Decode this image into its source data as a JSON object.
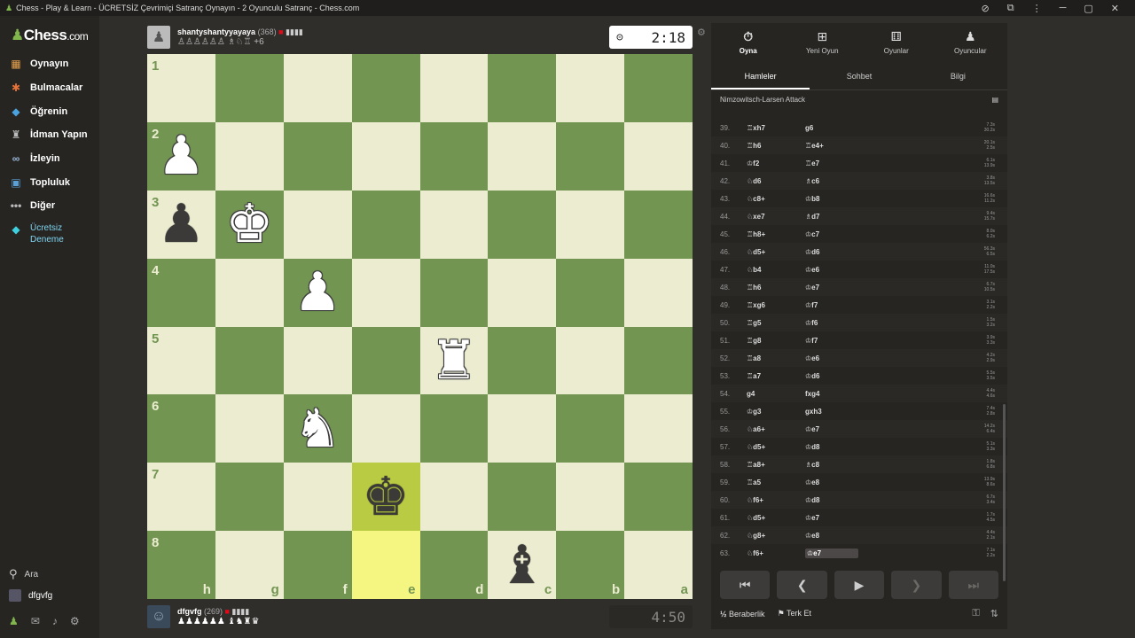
{
  "window": {
    "title": "Chess - Play & Learn - ÜCRETSİZ Çevrimiçi Satranç Oynayın - 2 Oyunculu Satranç - Chess.com"
  },
  "sidebar": {
    "logo_main": "Chess",
    "logo_dot": ".com",
    "items": [
      {
        "label": "Oynayın",
        "icon": "play-board-icon"
      },
      {
        "label": "Bulmacalar",
        "icon": "puzzle-icon"
      },
      {
        "label": "Öğrenin",
        "icon": "graduation-cap-icon"
      },
      {
        "label": "İdman Yapın",
        "icon": "train-icon"
      },
      {
        "label": "İzleyin",
        "icon": "binoculars-icon"
      },
      {
        "label": "Topluluk",
        "icon": "community-icon"
      },
      {
        "label": "Diğer",
        "icon": "more-dots-icon"
      },
      {
        "label": "Ücretsiz Deneme",
        "icon": "diamond-icon"
      }
    ],
    "search_label": "Ara",
    "username": "dfgvfg"
  },
  "top_player": {
    "name": "shantyshantyyayaya",
    "rating": "(368)",
    "captured": "♙♙♙♙♙♙ ♗♘♖ +6",
    "clock": "2:18"
  },
  "bottom_player": {
    "name": "dfgvfg",
    "rating": "(269)",
    "captured": "♟♟♟♟♟♟ ♝♞♜♛",
    "clock": "4:50"
  },
  "board": {
    "ranks": [
      "1",
      "2",
      "3",
      "4",
      "5",
      "6",
      "7",
      "8"
    ],
    "files": [
      "h",
      "g",
      "f",
      "e",
      "d",
      "c",
      "b",
      "a"
    ],
    "pieces": [
      {
        "sq": "h2",
        "glyph": "♟",
        "color": "w"
      },
      {
        "sq": "h3",
        "glyph": "♟",
        "color": "b"
      },
      {
        "sq": "g3",
        "glyph": "♚",
        "color": "w"
      },
      {
        "sq": "f4",
        "glyph": "♟",
        "color": "w"
      },
      {
        "sq": "d5",
        "glyph": "♜",
        "color": "w"
      },
      {
        "sq": "f6",
        "glyph": "♞",
        "color": "w"
      },
      {
        "sq": "e7",
        "glyph": "♚",
        "color": "b"
      },
      {
        "sq": "c8",
        "glyph": "♝",
        "color": "b"
      }
    ],
    "highlights": [
      "e7",
      "e8"
    ]
  },
  "panel": {
    "tabs": [
      {
        "label": "Oyna",
        "icon": "stopwatch-icon"
      },
      {
        "label": "Yeni Oyun",
        "icon": "plus-icon"
      },
      {
        "label": "Oyunlar",
        "icon": "dice-icon"
      },
      {
        "label": "Oyuncular",
        "icon": "players-icon"
      }
    ],
    "subtabs": [
      "Hamleler",
      "Sohbet",
      "Bilgi"
    ],
    "opening": "Nimzowitsch-Larsen Attack",
    "moves": [
      {
        "n": "39.",
        "w": "♖xh7",
        "b": "g6",
        "t1": "7.3s",
        "t2": "30.2s"
      },
      {
        "n": "40.",
        "w": "♖h6",
        "b": "♖e4+",
        "t1": "20.1s",
        "t2": "2.5s"
      },
      {
        "n": "41.",
        "w": "♔f2",
        "b": "♖e7",
        "t1": "6.1s",
        "t2": "13.9s"
      },
      {
        "n": "42.",
        "w": "♘d6",
        "b": "♗c6",
        "t1": "3.8s",
        "t2": "13.5s"
      },
      {
        "n": "43.",
        "w": "♘c8+",
        "b": "♔b8",
        "t1": "16.6s",
        "t2": "11.2s"
      },
      {
        "n": "44.",
        "w": "♘xe7",
        "b": "♗d7",
        "t1": "9.4s",
        "t2": "15.7s"
      },
      {
        "n": "45.",
        "w": "♖h8+",
        "b": "♔c7",
        "t1": "8.0s",
        "t2": "6.2s"
      },
      {
        "n": "46.",
        "w": "♘d5+",
        "b": "♔d6",
        "t1": "56.3s",
        "t2": "6.5s"
      },
      {
        "n": "47.",
        "w": "♘b4",
        "b": "♔e6",
        "t1": "11.0s",
        "t2": "17.5s"
      },
      {
        "n": "48.",
        "w": "♖h6",
        "b": "♔e7",
        "t1": "6.7s",
        "t2": "10.5s"
      },
      {
        "n": "49.",
        "w": "♖xg6",
        "b": "♔f7",
        "t1": "3.1s",
        "t2": "2.2s"
      },
      {
        "n": "50.",
        "w": "♖g5",
        "b": "♔f6",
        "t1": "1.5s",
        "t2": "3.2s"
      },
      {
        "n": "51.",
        "w": "♖g8",
        "b": "♔f7",
        "t1": "3.9s",
        "t2": "3.3s"
      },
      {
        "n": "52.",
        "w": "♖a8",
        "b": "♔e6",
        "t1": "4.2s",
        "t2": "2.9s"
      },
      {
        "n": "53.",
        "w": "♖a7",
        "b": "♔d6",
        "t1": "5.5s",
        "t2": "3.5s"
      },
      {
        "n": "54.",
        "w": "g4",
        "b": "fxg4",
        "t1": "4.4s",
        "t2": "4.6s"
      },
      {
        "n": "55.",
        "w": "♔g3",
        "b": "gxh3",
        "t1": "7.4s",
        "t2": "2.8s"
      },
      {
        "n": "56.",
        "w": "♘a6+",
        "b": "♔e7",
        "t1": "14.2s",
        "t2": "6.4s"
      },
      {
        "n": "57.",
        "w": "♘d5+",
        "b": "♔d8",
        "t1": "5.1s",
        "t2": "3.3s"
      },
      {
        "n": "58.",
        "w": "♖a8+",
        "b": "♗c8",
        "t1": "1.8s",
        "t2": "6.8s"
      },
      {
        "n": "59.",
        "w": "♖a5",
        "b": "♔e8",
        "t1": "13.9s",
        "t2": "8.6s"
      },
      {
        "n": "60.",
        "w": "♘f6+",
        "b": "♔d8",
        "t1": "6.7s",
        "t2": "3.4s"
      },
      {
        "n": "61.",
        "w": "♘d5+",
        "b": "♔e7",
        "t1": "1.7s",
        "t2": "4.5s"
      },
      {
        "n": "62.",
        "w": "♘g8+",
        "b": "♔e8",
        "t1": "4.4s",
        "t2": "2.1s"
      },
      {
        "n": "63.",
        "w": "♘f6+",
        "b": "♔e7",
        "t1": "7.1s",
        "t2": "2.2s"
      }
    ],
    "draw_label": "Beraberlik",
    "draw_icon": "½",
    "resign_label": "Terk Et"
  }
}
